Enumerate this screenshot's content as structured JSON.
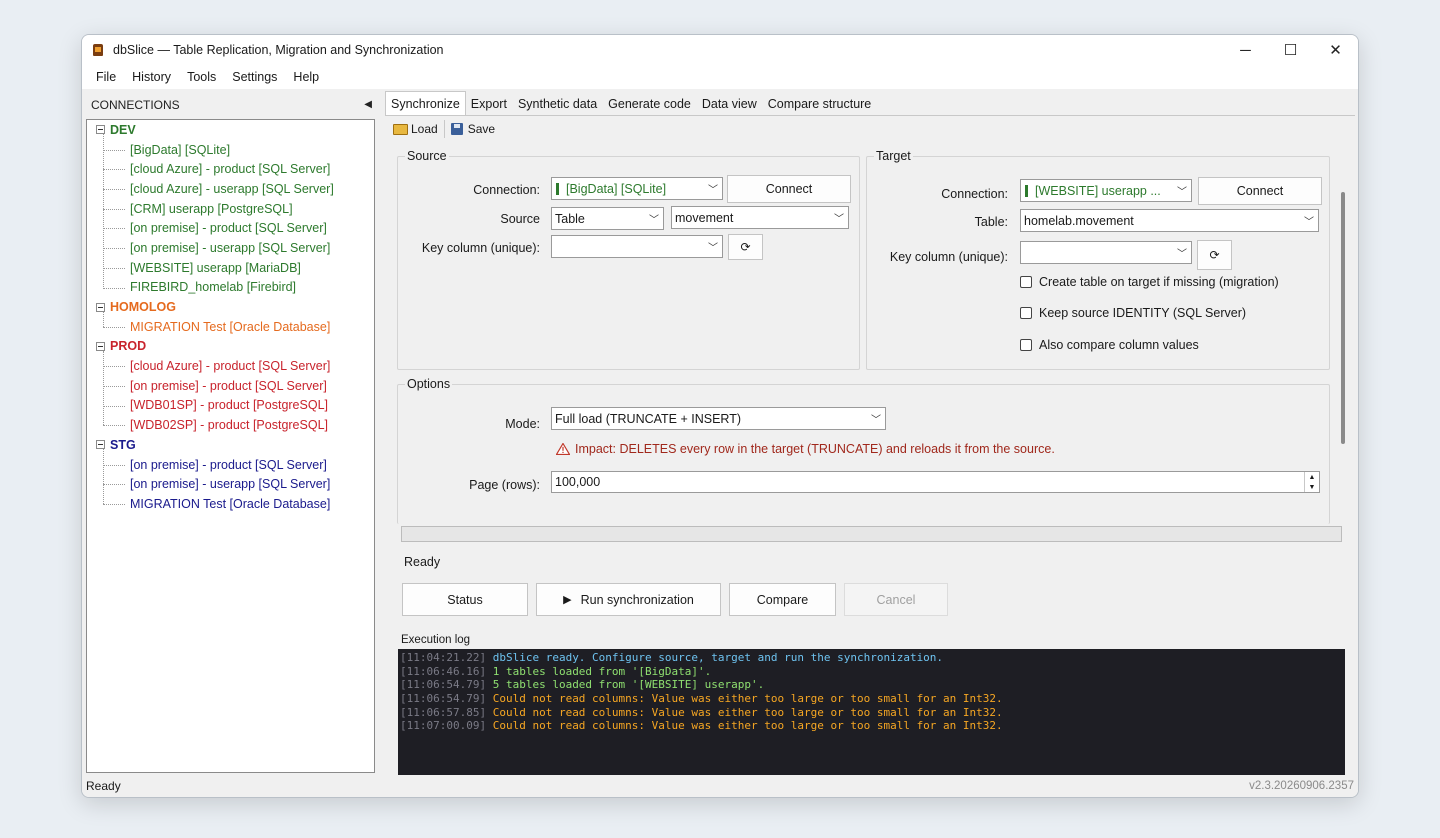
{
  "window": {
    "title": "dbSlice — Table Replication, Migration and Synchronization"
  },
  "menu": [
    "File",
    "History",
    "Tools",
    "Settings",
    "Help"
  ],
  "sidebar": {
    "header": "CONNECTIONS",
    "collapse_glyph": "◀",
    "groups": [
      {
        "name": "DEV",
        "color": "#2d7a2d",
        "items": [
          "[BigData]  [SQLite]",
          "[cloud Azure] - product  [SQL Server]",
          "[cloud Azure] - userapp  [SQL Server]",
          "[CRM] userapp  [PostgreSQL]",
          "[on premise] - product  [SQL Server]",
          "[on premise] - userapp  [SQL Server]",
          "[WEBSITE] userapp  [MariaDB]",
          "FIREBIRD_homelab  [Firebird]"
        ]
      },
      {
        "name": "HOMOLOG",
        "color": "#e56a1e",
        "items": [
          "MIGRATION Test  [Oracle Database]"
        ]
      },
      {
        "name": "PROD",
        "color": "#c8232c",
        "items": [
          "[cloud Azure] - product  [SQL Server]",
          "[on premise] - product  [SQL Server]",
          "[WDB01SP] - product  [PostgreSQL]",
          "[WDB02SP] - product  [PostgreSQL]"
        ]
      },
      {
        "name": "STG",
        "color": "#1a1a8c",
        "items": [
          "[on premise] - product  [SQL Server]",
          "[on premise] - userapp  [SQL Server]",
          "MIGRATION Test  [Oracle Database]"
        ]
      }
    ]
  },
  "tabs": [
    "Synchronize",
    "Export",
    "Synthetic data",
    "Generate code",
    "Data view",
    "Compare structure"
  ],
  "toolbar": {
    "load": "Load",
    "save": "Save"
  },
  "source": {
    "legend": "Source",
    "connection_label": "Connection:",
    "connection_value": "[BigData]  [SQLite]",
    "connect_button": "Connect",
    "source_label": "Source",
    "source_type": "Table",
    "source_object": "movement",
    "key_label": "Key column (unique):",
    "key_value": "",
    "refresh_glyph": "⟳"
  },
  "target": {
    "legend": "Target",
    "connection_label": "Connection:",
    "connection_value": "[WEBSITE] userapp   ...",
    "connect_button": "Connect",
    "table_label": "Table:",
    "table_value": "homelab.movement",
    "key_label": "Key column (unique):",
    "key_value": "",
    "refresh_glyph": "⟳",
    "checkboxes": [
      {
        "label": "Create table on target if missing (migration)",
        "checked": false
      },
      {
        "label": "Keep source IDENTITY (SQL Server)",
        "checked": false
      },
      {
        "label": "Also compare column values",
        "checked": false
      }
    ]
  },
  "options": {
    "legend": "Options",
    "mode_label": "Mode:",
    "mode_value": "Full load (TRUNCATE + INSERT)",
    "impact_text": "Impact: DELETES every row in the target (TRUNCATE) and reloads it from the source.",
    "page_label": "Page (rows):",
    "page_value": "100,000"
  },
  "progress": {
    "value": 0
  },
  "status_text": "Ready",
  "actions": {
    "status": "Status",
    "run": "Run synchronization",
    "run_glyph": "▶",
    "compare": "Compare",
    "cancel": "Cancel"
  },
  "log": {
    "title": "Execution log",
    "lines": [
      {
        "time": "[11:04:21.22]",
        "text": "dbSlice ready. Configure source, target and run the synchronization.",
        "color": "#6ec3f0"
      },
      {
        "time": "[11:06:46.16]",
        "text": "1 tables loaded from '[BigData]'.",
        "color": "#8fe070"
      },
      {
        "time": "[11:06:54.79]",
        "text": "5 tables loaded from '[WEBSITE] userapp'.",
        "color": "#8fe070"
      },
      {
        "time": "[11:06:54.79]",
        "text": "Could not read columns: Value was either too large or too small for an Int32.",
        "color": "#f5a623"
      },
      {
        "time": "[11:06:57.85]",
        "text": "Could not read columns: Value was either too large or too small for an Int32.",
        "color": "#f5a623"
      },
      {
        "time": "[11:07:00.09]",
        "text": "Could not read columns: Value was either too large or too small for an Int32.",
        "color": "#f5a623"
      }
    ]
  },
  "statusbar": {
    "left": "Ready",
    "version": "v2.3.20260906.2357"
  }
}
